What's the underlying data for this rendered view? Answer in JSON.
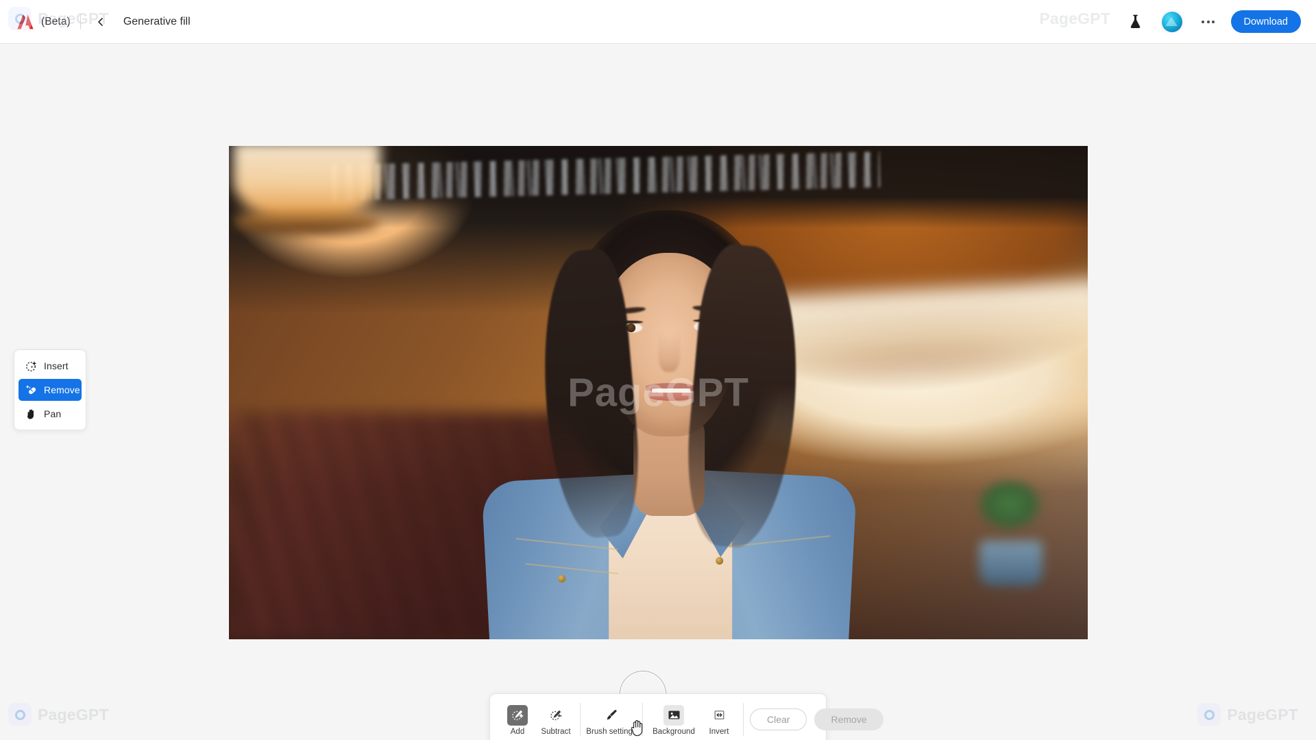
{
  "header": {
    "brand_logo": "adobe-logo",
    "beta_label": "(Beta)",
    "back_icon": "chevron-left-icon",
    "title": "Generative fill",
    "flask_icon": "flask-icon",
    "avatar_icon": "user-avatar",
    "more_icon": "more-options-icon",
    "download_label": "Download",
    "accent_blue": "#1473E6"
  },
  "tool_panel": {
    "items": [
      {
        "label": "Insert",
        "icon": "insert-sparkle-icon",
        "selected": false
      },
      {
        "label": "Remove",
        "icon": "remove-eraser-sparkle-icon",
        "selected": true
      },
      {
        "label": "Pan",
        "icon": "hand-pan-icon",
        "selected": false
      }
    ]
  },
  "canvas": {
    "watermark": "PageGPT",
    "brush_cursor": "brush-circle-cursor"
  },
  "bottom_toolbar": {
    "selection_tools": [
      {
        "label": "Add",
        "icon": "brush-add-icon",
        "state": "selected"
      },
      {
        "label": "Subtract",
        "icon": "brush-subtract-icon",
        "state": "default"
      }
    ],
    "brush_tools": [
      {
        "label": "Brush settings",
        "icon": "paintbrush-icon",
        "state": "default"
      }
    ],
    "mask_tools": [
      {
        "label": "Background",
        "icon": "image-picture-icon",
        "state": "hovered"
      },
      {
        "label": "Invert",
        "icon": "invert-selection-icon",
        "state": "default"
      }
    ],
    "actions": [
      {
        "label": "Clear",
        "style": "outline",
        "disabled": true
      },
      {
        "label": "Remove",
        "style": "filled",
        "disabled": true
      }
    ]
  },
  "watermarks": {
    "brand": "PageGPT"
  }
}
